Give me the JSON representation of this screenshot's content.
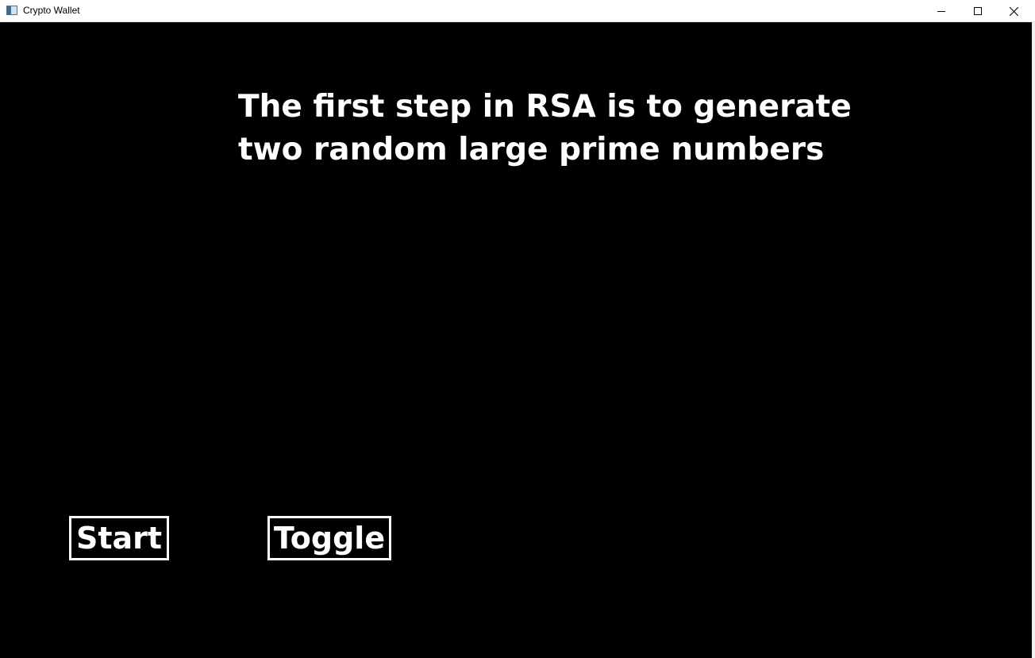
{
  "window": {
    "title": "Crypto Wallet",
    "icon": "app-window-icon",
    "controls": {
      "minimize_icon": "minimize-icon",
      "maximize_icon": "maximize-icon",
      "close_icon": "close-icon"
    }
  },
  "main": {
    "heading_line1": "The first step in RSA is to generate",
    "heading_line2": "two random large prime numbers",
    "background_color": "#000000",
    "text_color": "#ffffff"
  },
  "buttons": {
    "start_label": "Start",
    "toggle_label": "Toggle"
  }
}
